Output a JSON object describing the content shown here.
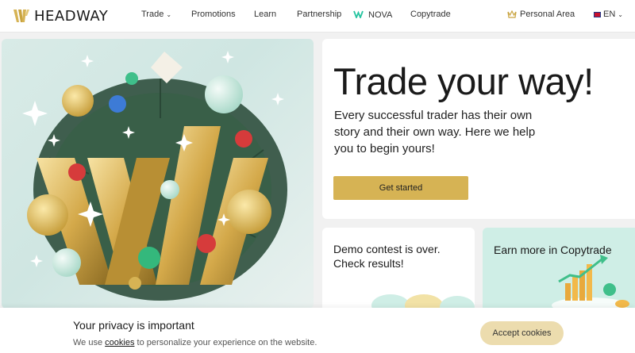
{
  "brand": {
    "name": "HEADWAY",
    "accent": "#d6b354",
    "nova_color": "#25c4a0"
  },
  "nav": {
    "trade": "Trade",
    "promotions": "Promotions",
    "learn": "Learn",
    "partnership": "Partnership",
    "nova": "NOVA",
    "copytrade": "Copytrade",
    "personal_area": "Personal Area",
    "language": "EN"
  },
  "hero": {
    "title": "Trade your way!",
    "description": "Every successful trader has their own story and their own way. Here we help you to begin yours!",
    "cta": "Get started"
  },
  "cards": {
    "demo": "Demo contest is over. Check results!",
    "copytrade": "Earn more in Copytrade"
  },
  "cookie": {
    "title": "Your privacy is important",
    "text_before": "We use",
    "link": "cookies",
    "text_after": "to personalize your experience on the website.",
    "accept": "Accept cookies"
  }
}
